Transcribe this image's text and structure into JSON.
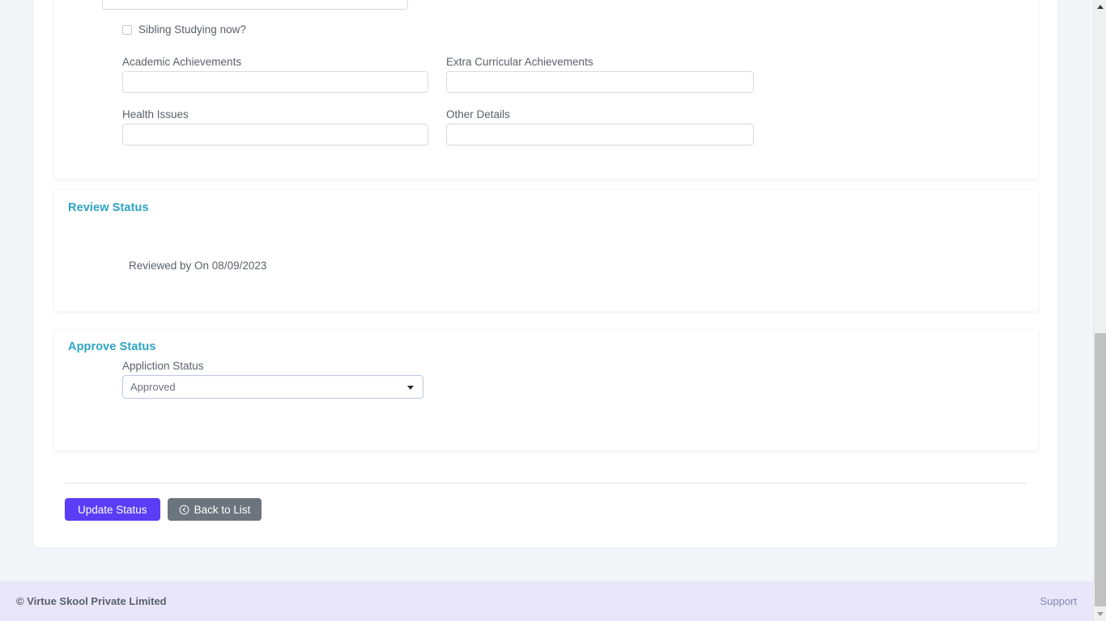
{
  "personal": {
    "checkbox": {
      "label": "Sibling Studying now?",
      "checked": false
    },
    "fields": [
      {
        "label": "Academic Achievements",
        "value": "",
        "placeholder": ""
      },
      {
        "label": "Extra Curricular Achievements",
        "value": "",
        "placeholder": ""
      },
      {
        "label": "Health Issues",
        "value": "",
        "placeholder": ""
      },
      {
        "label": "Other Details",
        "value": "",
        "placeholder": ""
      }
    ]
  },
  "review": {
    "title": "Review Status",
    "line": "Reviewed by On 08/09/2023"
  },
  "approve": {
    "title": "Approve Status",
    "status_label": "Appliction Status",
    "status_value": "Approved",
    "status_options": [
      "Approved"
    ]
  },
  "actions": {
    "update_label": "Update Status",
    "back_label": "Back to List",
    "back_icon": "arrow-circle-left-icon"
  },
  "footer": {
    "copyright": "© Virtue Skool Private Limited",
    "support": "Support"
  },
  "colors": {
    "accent_heading": "#2fa3c4",
    "primary_button": "#5a3df5",
    "secondary_button": "#6c757d",
    "page_background": "#f4f5f9",
    "footer_background": "#e9e6fb"
  },
  "scrollbar": {
    "up_icon": "caret-up-icon",
    "down_icon": "caret-down-icon"
  }
}
